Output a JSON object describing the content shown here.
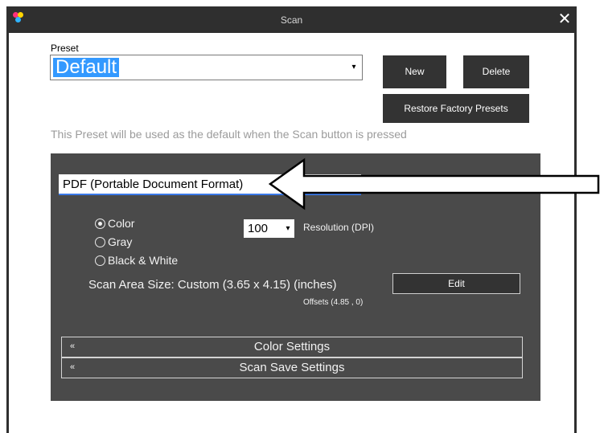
{
  "window": {
    "title": "Scan",
    "close_symbol": "✕",
    "title_bar_color": "#2f2f2f"
  },
  "preset": {
    "label": "Preset",
    "selected_value": "Default",
    "dropdown_arrow": "▾",
    "hint": "This Preset will be used as the default when the Scan button is pressed"
  },
  "buttons": {
    "new_label": "New",
    "delete_label": "Delete",
    "restore_label": "Restore Factory Presets",
    "edit_label": "Edit"
  },
  "scan_panel": {
    "format_value": "PDF (Portable Document Format)",
    "color_modes": [
      {
        "label": "Color",
        "checked": true
      },
      {
        "label": "Gray",
        "checked": false
      },
      {
        "label": "Black & White",
        "checked": false
      }
    ],
    "resolution_value": "100",
    "resolution_arrow": "▾",
    "resolution_label": "Resolution (DPI)",
    "scan_area_text": "Scan Area Size:  Custom (3.65 x 4.15) (inches)",
    "offsets_text": "Offsets (4.85 , 0)",
    "sections": [
      {
        "icon": "«",
        "label": "Color Settings"
      },
      {
        "icon": "«",
        "label": "Scan Save Settings"
      }
    ]
  },
  "colors": {
    "selection_blue": "#3399ff",
    "panel_gray": "#4a4a4a",
    "focus_blue": "#3a79e8"
  },
  "icons": {
    "app": "multicolor-app-icon",
    "close": "close-icon",
    "dropdown": "chevron-down-icon",
    "section": "double-chevron-up-icon",
    "annotation": "arrow-left-icon"
  }
}
